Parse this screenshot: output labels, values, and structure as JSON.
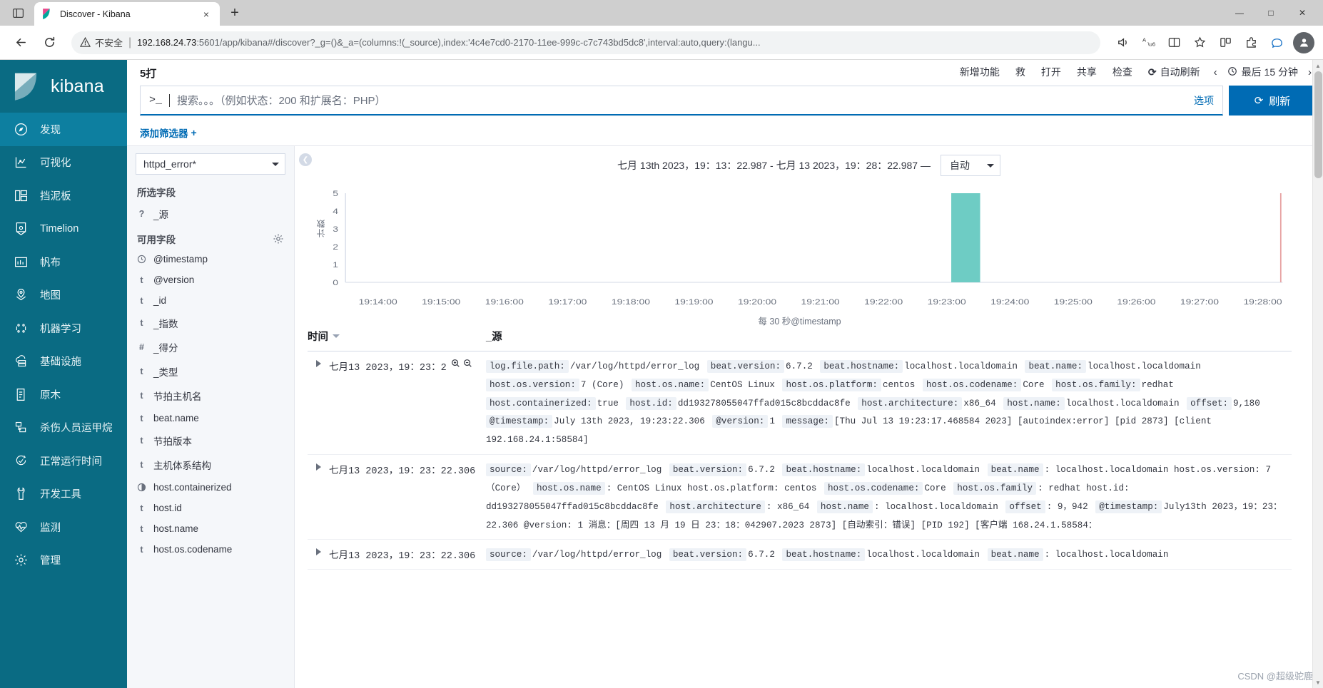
{
  "browser": {
    "tab": {
      "title": "Discover - Kibana",
      "favicon": "kibana-logo-icon",
      "close": "×"
    },
    "newtab_label": "+",
    "window_controls": {
      "minimize": "—",
      "maximize": "□",
      "close": "✕"
    },
    "omnibox": {
      "security_label": "不安全",
      "separator": "|",
      "host": "192.168.24.73",
      "path": ":5601/app/kibana#/discover?_g=()&_a=(columns:!(_source),index:'4c4e7cd0-2170-11ee-999c-c7c743bd5dc8',interval:auto,query:(langu..."
    },
    "actions": [
      "back-icon",
      "reload-icon",
      "read-aloud-icon",
      "translate-icon",
      "split-screen-icon",
      "favorite-icon",
      "collections-icon",
      "extensions-icon",
      "copilot-icon",
      "profile-icon"
    ]
  },
  "kibana": {
    "logo_text": "kibana",
    "nav_items": [
      {
        "label": "发现",
        "icon": "compass-icon",
        "active": true
      },
      {
        "label": "可视化",
        "icon": "bar-chart-icon",
        "active": false
      },
      {
        "label": "挡泥板",
        "icon": "dashboard-icon",
        "active": false
      },
      {
        "label": "Timelion",
        "icon": "timelion-icon",
        "active": false
      },
      {
        "label": "帆布",
        "icon": "canvas-icon",
        "active": false
      },
      {
        "label": "地图",
        "icon": "map-pin-icon",
        "active": false
      },
      {
        "label": "机器学习",
        "icon": "machine-learning-icon",
        "active": false
      },
      {
        "label": "基础设施",
        "icon": "infrastructure-icon",
        "active": false
      },
      {
        "label": "原木",
        "icon": "logs-icon",
        "active": false
      },
      {
        "label": "杀伤人员运甲烷",
        "icon": "apm-icon",
        "active": false
      },
      {
        "label": "正常运行时间",
        "icon": "uptime-icon",
        "active": false
      },
      {
        "label": "开发工具",
        "icon": "wrench-icon",
        "active": false
      },
      {
        "label": "监测",
        "icon": "monitoring-icon",
        "active": false
      },
      {
        "label": "管理",
        "icon": "gear-icon",
        "active": false
      }
    ],
    "topbar": {
      "saved_search_title": "5打",
      "buttons": [
        {
          "label": "新增功能",
          "name": "new-button"
        },
        {
          "label": "救",
          "name": "save-button"
        },
        {
          "label": "打开",
          "name": "open-button"
        },
        {
          "label": "共享",
          "name": "share-button"
        },
        {
          "label": "检查",
          "name": "inspect-button"
        }
      ],
      "auto_refresh_label": "自动刷新",
      "auto_refresh_icon": "refresh-icon",
      "prev_arrow": "‹",
      "next_arrow": "›",
      "time_range_label": "最后 15 分钟",
      "time_icon": "clock-icon"
    },
    "search": {
      "prompt": ">_",
      "placeholder": "搜索。。。（例如状态：200 和扩展名：PHP）",
      "value": "",
      "options_label": "选项",
      "refresh_label": "刷新",
      "refresh_icon": "refresh-icon"
    },
    "filter_bar": {
      "add_filter_label": "添加筛选器",
      "plus": "+"
    },
    "sidebar": {
      "index_pattern": "httpd_error*",
      "selected_fields_header": "所选字段",
      "selected_fields": [
        {
          "label": "_源",
          "type": "?"
        }
      ],
      "available_fields_header": "可用字段",
      "settings_icon": "gear-icon",
      "available_fields": [
        {
          "label": "@timestamp",
          "type": "clock"
        },
        {
          "label": "@version",
          "type": "t"
        },
        {
          "label": "_id",
          "type": "t"
        },
        {
          "label": "_指数",
          "type": "t"
        },
        {
          "label": "_得分",
          "type": "#"
        },
        {
          "label": "_类型",
          "type": "t"
        },
        {
          "label": "节拍主机名",
          "type": "t"
        },
        {
          "label": "beat.name",
          "type": "t"
        },
        {
          "label": "节拍版本",
          "type": "t"
        },
        {
          "label": "主机体系结构",
          "type": "t"
        },
        {
          "label": "host.containerized",
          "type": "bool"
        },
        {
          "label": "host.id",
          "type": "t"
        },
        {
          "label": "host.name",
          "type": "t"
        },
        {
          "label": "host.os.codename",
          "type": "t"
        }
      ]
    },
    "histogram": {
      "collapse_icon": "chevron-left-icon",
      "title": "七月 13th 2023，19：13：22.987 - 七月 13 2023，19：28：22.987 —",
      "interval_label": "自动",
      "interval_options": [
        "自动"
      ]
    },
    "doc_table": {
      "columns": [
        {
          "label": "时间",
          "name": "time-column",
          "sortable": true
        },
        {
          "label": "_源",
          "name": "source-column",
          "sortable": false
        }
      ],
      "rows": [
        {
          "time": "七月13 2023，19：23：2",
          "zoom_in_icon": "zoom-in-icon",
          "zoom_out_icon": "zoom-out-icon",
          "pairs": [
            {
              "k": "log.file.path:",
              "v": "/var/log/httpd/error_log"
            },
            {
              "k": "beat.version:",
              "v": "6.7.2"
            },
            {
              "k": "beat.hostname:",
              "v": "localhost.localdomain"
            },
            {
              "k": "beat.name:",
              "v": "localhost.localdomain"
            },
            {
              "k": "host.os.version:",
              "v": "7 (Core)"
            },
            {
              "k": "host.os.name:",
              "v": "CentOS Linux"
            },
            {
              "k": "host.os.platform:",
              "v": "centos"
            },
            {
              "k": "host.os.codename:",
              "v": "Core"
            },
            {
              "k": "host.os.family:",
              "v": "redhat"
            },
            {
              "k": "host.containerized:",
              "v": "true"
            },
            {
              "k": "host.id:",
              "v": "dd193278055047ffad015c8bcddac8fe"
            },
            {
              "k": "host.architecture:",
              "v": "x86_64"
            },
            {
              "k": "host.name:",
              "v": "localhost.localdomain"
            },
            {
              "k": "offset:",
              "v": "9,180"
            },
            {
              "k": "@timestamp:",
              "v": "July 13th 2023, 19:23:22.306"
            },
            {
              "k": "@version:",
              "v": "1"
            },
            {
              "k": "message:",
              "v": "[Thu Jul 13 19:23:17.468584 2023] [autoindex:error] [pid 2873] [client 192.168.24.1:58584]"
            }
          ]
        },
        {
          "time": "七月13 2023，19：23：22.306",
          "zoom_in_icon": "zoom-in-icon",
          "zoom_out_icon": "zoom-out-icon",
          "pairs": [
            {
              "k": "source:",
              "v": "/var/log/httpd/error_log"
            },
            {
              "k": "beat.version:",
              "v": "6.7.2"
            },
            {
              "k": "beat.hostname:",
              "v": "localhost.localdomain"
            },
            {
              "k": "beat.name",
              "v": ": localhost.localdomain host.os.version: 7（Core）"
            },
            {
              "k": "host.os.name",
              "v": ": CentOS Linux host.os.platform: centos"
            },
            {
              "k": "host.os.codename:",
              "v": "Core"
            },
            {
              "k": "host.os.family",
              "v": ": redhat host.id: dd193278055047ffad015c8bcddac8fe"
            },
            {
              "k": "host.architecture",
              "v": ": x86_64"
            },
            {
              "k": "host.name",
              "v": ": localhost.localdomain"
            },
            {
              "k": "offset",
              "v": ": 9，942"
            },
            {
              "k": "@timestamp:",
              "v": "July13th 2023，19：23：22.306 @version: 1 消息：[周四 13 月 19 日 23：18：042907.2023 2873] [自动索引：错误] [PID 192] [客户端 168.24.1.58584："
            }
          ]
        },
        {
          "time": "七月13 2023，19：23：22.306",
          "zoom_in_icon": "zoom-in-icon",
          "zoom_out_icon": "zoom-out-icon",
          "pairs": [
            {
              "k": "source:",
              "v": "/var/log/httpd/error_log"
            },
            {
              "k": "beat.version:",
              "v": "6.7.2"
            },
            {
              "k": "beat.hostname:",
              "v": "localhost.localdomain"
            },
            {
              "k": "beat.name",
              "v": ": localhost.localdomain"
            }
          ]
        }
      ]
    },
    "watermark": "CSDN @超级驼鹿"
  },
  "chart_data": {
    "type": "bar",
    "title": "七月 13th 2023，19：13：22.987 - 七月 13 2023，19：28：22.987 —",
    "xlabel": "每 30 秒@timestamp",
    "ylabel": "计数",
    "categories": [
      "19:14:00",
      "19:15:00",
      "19:16:00",
      "19:17:00",
      "19:18:00",
      "19:19:00",
      "19:20:00",
      "19:21:00",
      "19:22:00",
      "19:23:00",
      "19:24:00",
      "19:25:00",
      "19:26:00",
      "19:27:00",
      "19:28:00"
    ],
    "values": [
      0,
      0,
      0,
      0,
      0,
      0,
      0,
      0,
      0,
      5,
      0,
      0,
      0,
      0,
      0
    ],
    "ylim": [
      0,
      5
    ],
    "yticks": [
      0,
      1,
      2,
      3,
      4,
      5
    ],
    "bar_color": "#6eccc4",
    "grid": false,
    "legend": "none"
  },
  "colors": {
    "kibana_nav": "#0a6b83",
    "kibana_nav_active": "#0d7fa0",
    "primary": "#006bb4",
    "bar": "#6eccc4",
    "text": "#343741"
  }
}
